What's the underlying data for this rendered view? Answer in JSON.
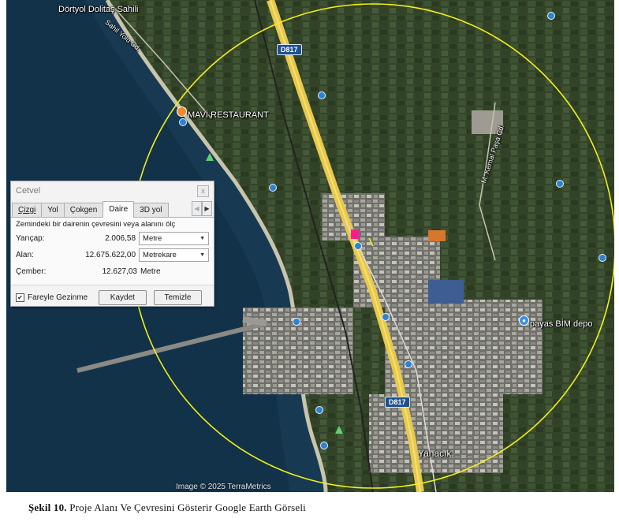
{
  "map": {
    "labels": {
      "dortyol": "Dörtyol Dolitaş Sahili",
      "sahil_yolu": "Sahil Yolu Cd.",
      "mavi": "MAVİ RESTAURANT",
      "kemal": "M. Kemal Paşa Cd.",
      "payas": "payas BİM depo",
      "yanacik": "Yanacık"
    },
    "road_shields": [
      "D817",
      "D817"
    ],
    "credit": "Image © 2025 TerraMetrics"
  },
  "ruler": {
    "title": "Cetvel",
    "close": "x",
    "tabs": [
      {
        "label": "Çizgi",
        "active": false
      },
      {
        "label": "Yol",
        "active": false
      },
      {
        "label": "Çokgen",
        "active": false
      },
      {
        "label": "Daire",
        "active": true
      },
      {
        "label": "3D yol",
        "active": false
      }
    ],
    "description": "Zemindeki bir dairenin çevresini veya alanını ölç",
    "radius": {
      "label": "Yarıçap:",
      "value": "2.006,58",
      "unit": "Metre"
    },
    "area": {
      "label": "Alan:",
      "value": "12.675.622,00",
      "unit": "Metrekare"
    },
    "circumference": {
      "label": "Çember:",
      "value": "12.627,03",
      "unit": "Metre"
    },
    "mouse_nav": {
      "label": "Fareyle Gezinme",
      "checked": true
    },
    "save_label": "Kaydet",
    "clear_label": "Temizle"
  },
  "caption": {
    "prefix": "Şekil 10.",
    "text": " Proje Alanı Ve Çevresini Gösterir Google Earth Görseli"
  },
  "colors": {
    "circle": "#f4f01a",
    "highway": "#e8c94a",
    "sea": "#173a52"
  }
}
